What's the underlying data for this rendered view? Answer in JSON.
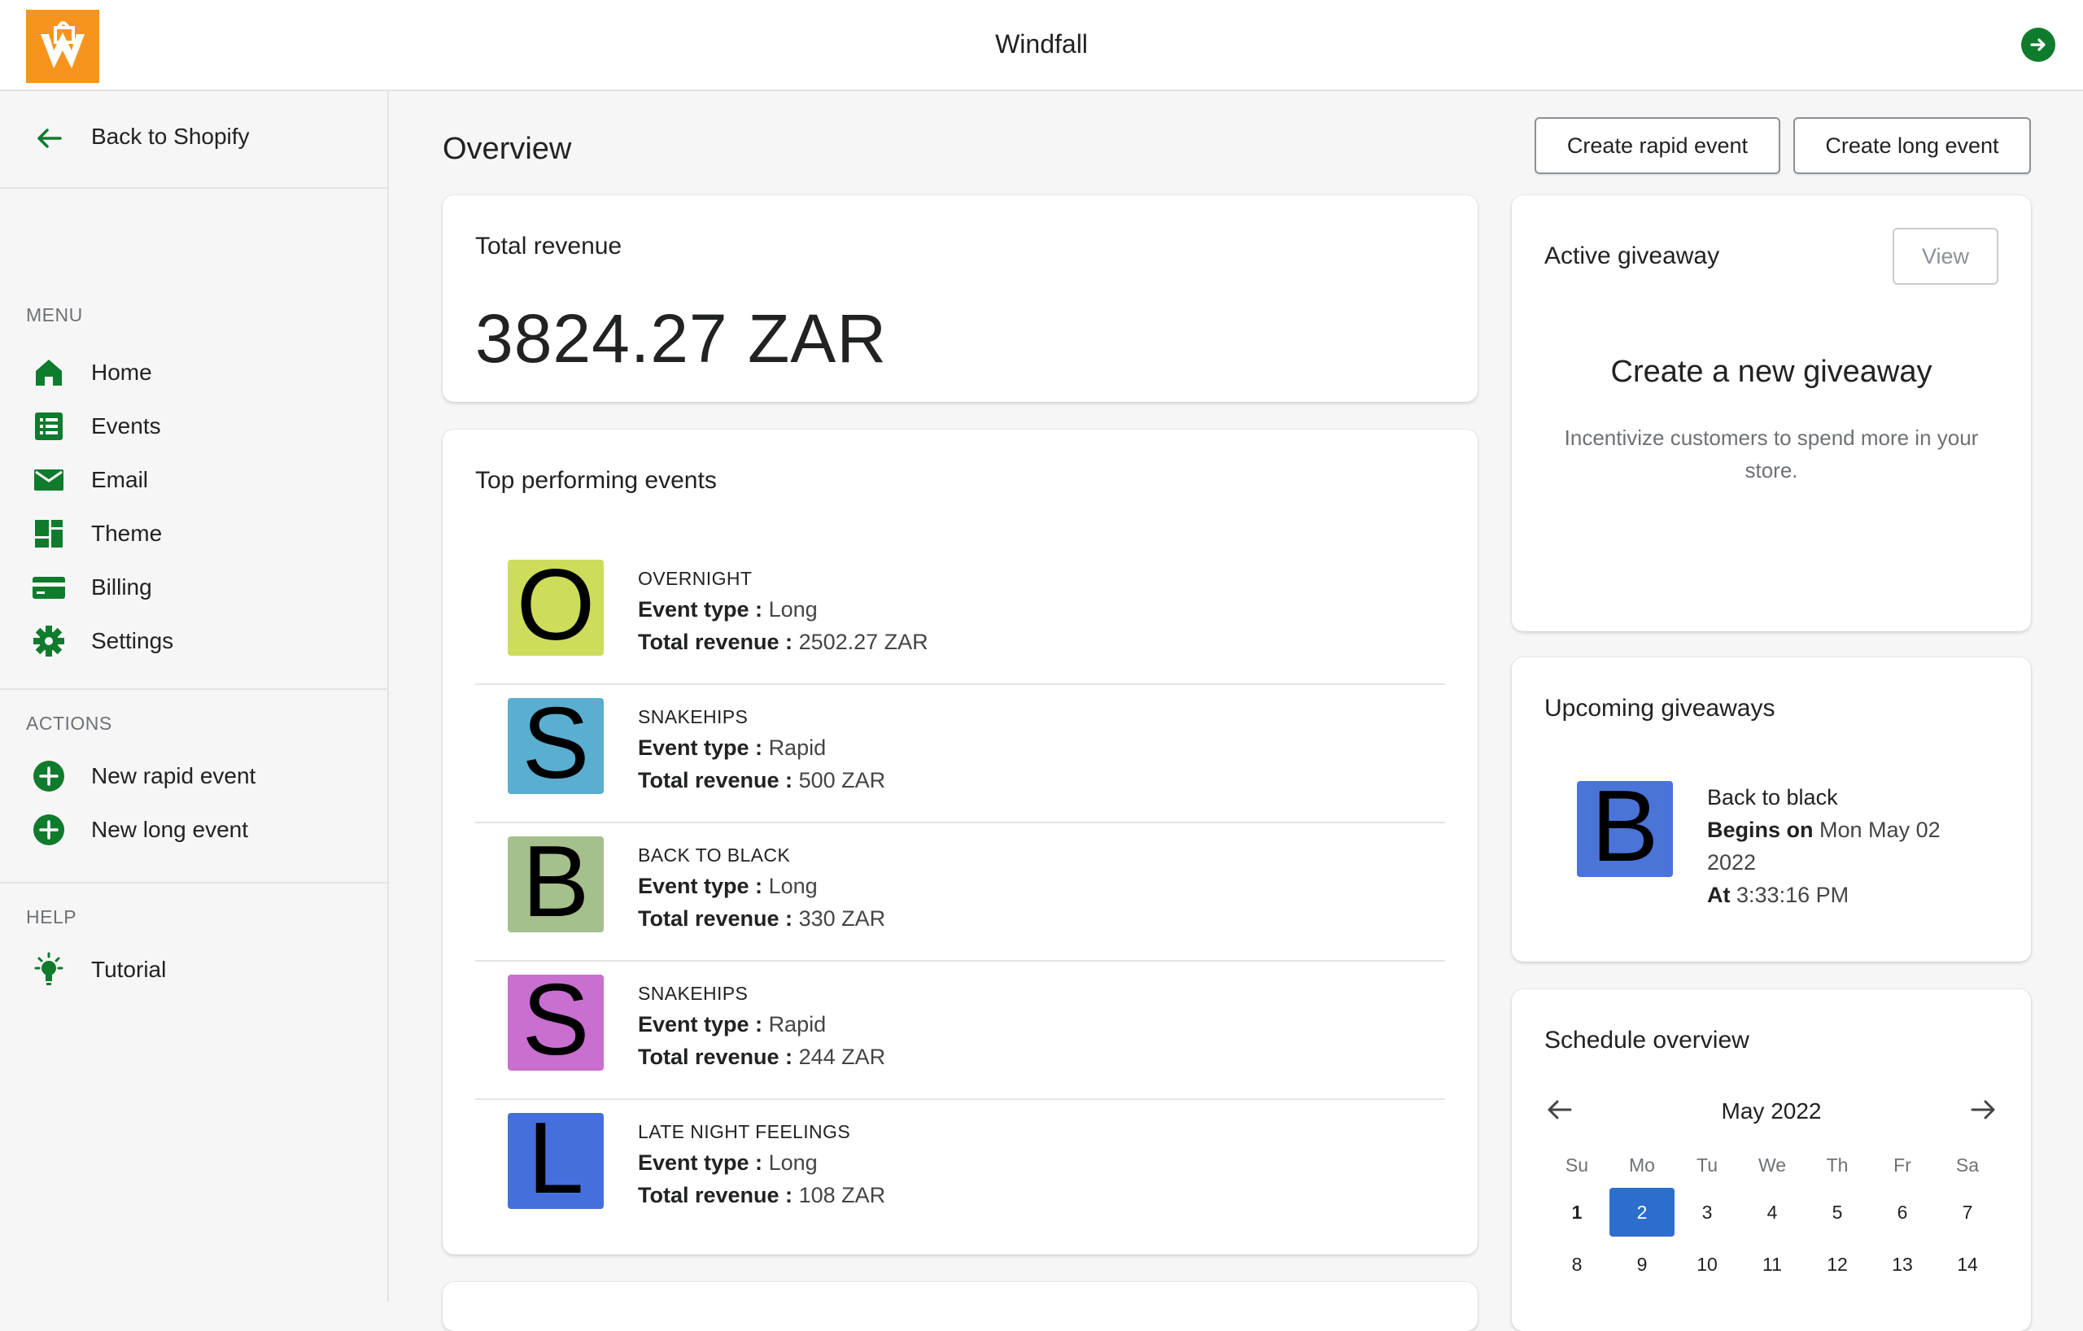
{
  "app": {
    "title": "Windfall",
    "exit_icon": "arrow-right-circle-icon"
  },
  "sidebar": {
    "back": {
      "label": "Back to Shopify",
      "icon": "arrow-left-icon"
    },
    "menu": {
      "title": "MENU",
      "items": [
        {
          "label": "Home",
          "icon": "home-icon"
        },
        {
          "label": "Events",
          "icon": "list-icon"
        },
        {
          "label": "Email",
          "icon": "email-icon"
        },
        {
          "label": "Theme",
          "icon": "theme-icon"
        },
        {
          "label": "Billing",
          "icon": "credit-card-icon"
        },
        {
          "label": "Settings",
          "icon": "gear-icon"
        }
      ]
    },
    "actions": {
      "title": "ACTIONS",
      "items": [
        {
          "label": "New rapid event",
          "icon": "plus-circle-icon"
        },
        {
          "label": "New long event",
          "icon": "plus-circle-icon"
        }
      ]
    },
    "help": {
      "title": "HELP",
      "items": [
        {
          "label": "Tutorial",
          "icon": "lightbulb-icon"
        }
      ]
    }
  },
  "main": {
    "title": "Overview",
    "buttons": {
      "create_rapid": "Create rapid event",
      "create_long": "Create long event"
    },
    "total_revenue": {
      "title": "Total revenue",
      "value": "3824.27 ZAR"
    },
    "top_events": {
      "title": "Top performing events",
      "type_label": "Event type :",
      "revenue_label": "Total revenue :",
      "rows": [
        {
          "letter": "O",
          "color": "#cddc5a",
          "name": "OVERNIGHT",
          "type": "Long",
          "revenue": "2502.27 ZAR"
        },
        {
          "letter": "S",
          "color": "#5aaed0",
          "name": "SNAKEHIPS",
          "type": "Rapid",
          "revenue": "500 ZAR"
        },
        {
          "letter": "B",
          "color": "#a5c08d",
          "name": "BACK TO BLACK",
          "type": "Long",
          "revenue": "330 ZAR"
        },
        {
          "letter": "S",
          "color": "#c86fd0",
          "name": "SNAKEHIPS",
          "type": "Rapid",
          "revenue": "244 ZAR"
        },
        {
          "letter": "L",
          "color": "#4570dc",
          "name": "LATE NIGHT FEELINGS",
          "type": "Long",
          "revenue": "108 ZAR"
        }
      ]
    }
  },
  "right": {
    "active_giveaway": {
      "title": "Active giveaway",
      "view_label": "View",
      "empty_title": "Create a new giveaway",
      "empty_sub": "Incentivize customers to spend more in your store."
    },
    "upcoming": {
      "title": "Upcoming giveaways",
      "item": {
        "letter": "B",
        "color": "#4a74d8",
        "name": "Back to black",
        "begins_label": "Begins on",
        "begins_value": "Mon May 02",
        "year": "2022",
        "at_label": "At",
        "at_value": "3:33:16 PM"
      }
    },
    "schedule": {
      "title": "Schedule overview",
      "month": "May 2022",
      "weekdays": [
        "Su",
        "Mo",
        "Tu",
        "We",
        "Th",
        "Fr",
        "Sa"
      ],
      "weeks": [
        [
          "1",
          "2",
          "3",
          "4",
          "5",
          "6",
          "7"
        ],
        [
          "8",
          "9",
          "10",
          "11",
          "12",
          "13",
          "14"
        ]
      ],
      "selected_day": "2",
      "bold_day": "1"
    }
  },
  "colors": {
    "brand_green": "#0f7b2c",
    "selected_blue": "#2c6ecb",
    "logo_orange": "#f7941d"
  }
}
